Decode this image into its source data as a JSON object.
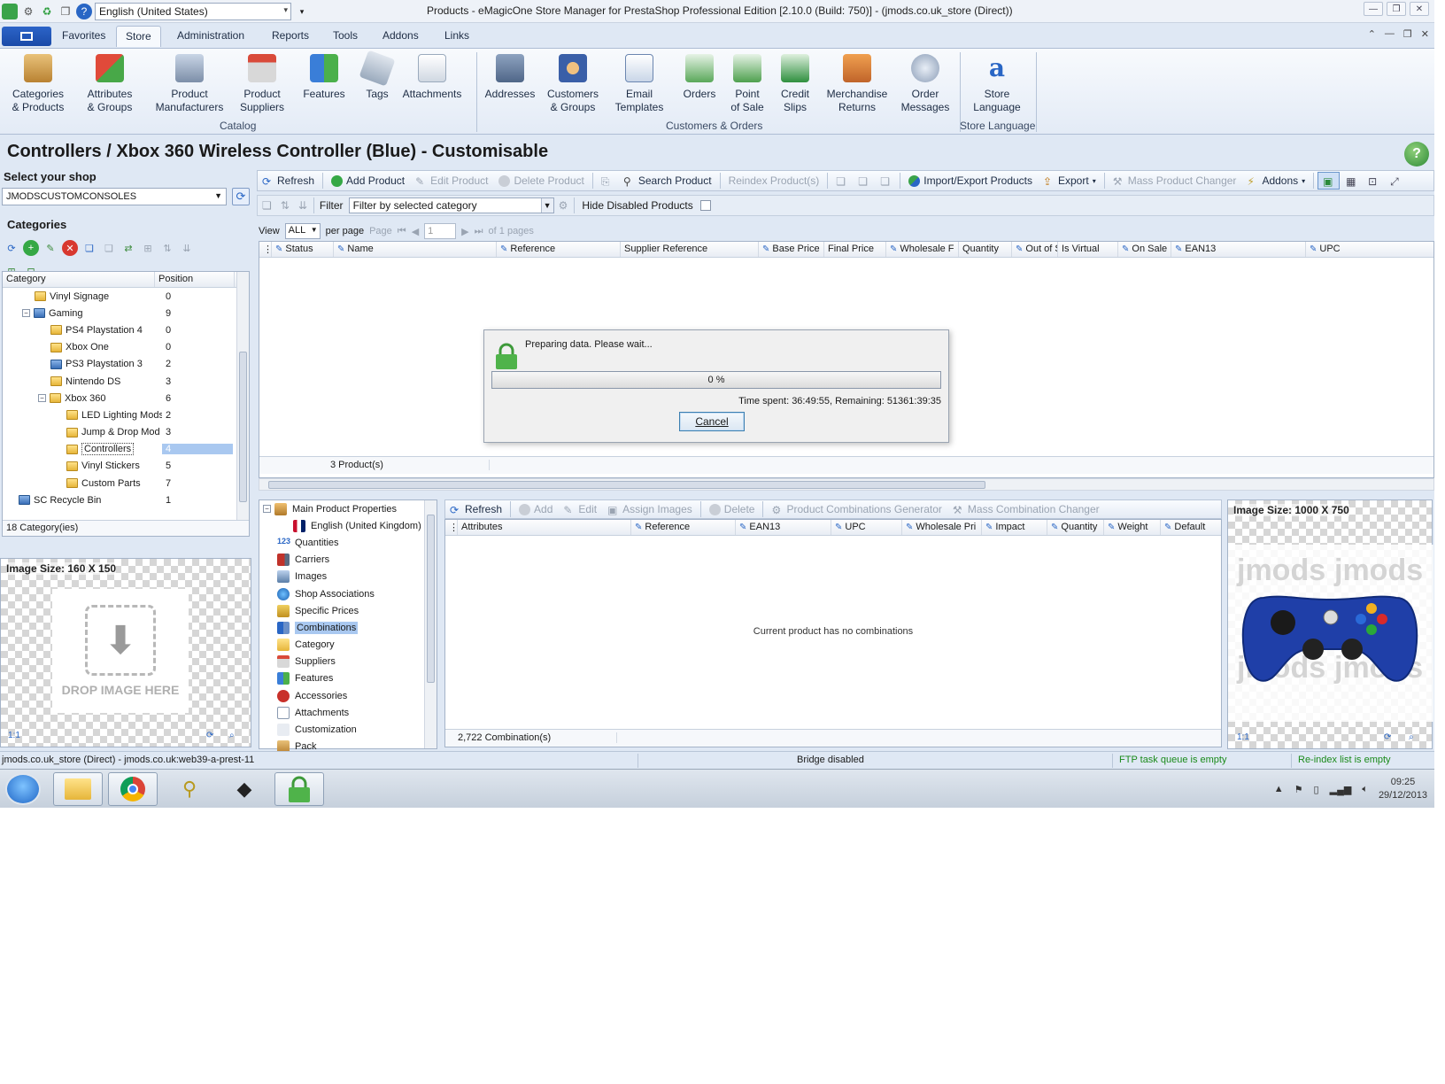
{
  "window": {
    "title": "Products - eMagicOne Store Manager for PrestaShop Professional Edition [2.10.0 (Build: 750)] - (jmods.co.uk_store (Direct))",
    "language": "English (United States)"
  },
  "ribbon_tabs": [
    "Favorites",
    "Store",
    "Administration",
    "Reports",
    "Tools",
    "Addons",
    "Links"
  ],
  "ribbon": {
    "catalog": {
      "group_label": "Catalog",
      "buttons": [
        {
          "line1": "Categories",
          "line2": "& Products"
        },
        {
          "line1": "Attributes",
          "line2": "& Groups"
        },
        {
          "line1": "Product",
          "line2": "Manufacturers"
        },
        {
          "line1": "Product",
          "line2": "Suppliers"
        },
        {
          "line1": "Features",
          "line2": ""
        },
        {
          "line1": "Tags",
          "line2": ""
        },
        {
          "line1": "Attachments",
          "line2": ""
        }
      ]
    },
    "customers": {
      "group_label": "Customers & Orders",
      "buttons": [
        {
          "line1": "Addresses",
          "line2": ""
        },
        {
          "line1": "Customers",
          "line2": "& Groups"
        },
        {
          "line1": "Email",
          "line2": "Templates"
        },
        {
          "line1": "Orders",
          "line2": ""
        },
        {
          "line1": "Point",
          "line2": "of Sale"
        },
        {
          "line1": "Credit",
          "line2": "Slips"
        },
        {
          "line1": "Merchandise",
          "line2": "Returns"
        },
        {
          "line1": "Order",
          "line2": "Messages"
        }
      ]
    },
    "language": {
      "group_label": "Store Language",
      "buttons": [
        {
          "line1": "Store",
          "line2": "Language"
        }
      ]
    }
  },
  "page_heading": "Controllers / Xbox 360 Wireless Controller (Blue) - Customisable",
  "left": {
    "select_shop_label": "Select your shop",
    "shop_value": "JMODSCUSTOMCONSOLES",
    "categories_label": "Categories",
    "grid_headers": [
      "Category",
      "Position"
    ],
    "rows": [
      {
        "name": "Vinyl Signage",
        "pos": "0"
      },
      {
        "name": "Gaming",
        "pos": "9"
      },
      {
        "name": "PS4 Playstation 4",
        "pos": "0"
      },
      {
        "name": "Xbox One",
        "pos": "0"
      },
      {
        "name": "PS3 Playstation 3",
        "pos": "2"
      },
      {
        "name": "Nintendo DS",
        "pos": "3"
      },
      {
        "name": "Xbox 360",
        "pos": "6"
      },
      {
        "name": "LED Lighting Mods",
        "pos": "2"
      },
      {
        "name": "Jump & Drop Mod",
        "pos": "3"
      },
      {
        "name": "Controllers",
        "pos": "4"
      },
      {
        "name": "Vinyl Stickers",
        "pos": "5"
      },
      {
        "name": "Custom Parts",
        "pos": "7"
      },
      {
        "name": "SC Recycle Bin",
        "pos": "1"
      }
    ],
    "footer": "18 Category(ies)",
    "image_size": "Image Size: 160 X 150",
    "drop_text": "DROP IMAGE HERE"
  },
  "toolbar": {
    "refresh": "Refresh",
    "add_product": "Add Product",
    "edit_product": "Edit Product",
    "delete_product": "Delete Product",
    "search_product": "Search Product",
    "reindex": "Reindex Product(s)",
    "import_export": "Import/Export Products",
    "export": "Export",
    "mass_changer": "Mass Product Changer",
    "addons": "Addons"
  },
  "filter": {
    "label": "Filter",
    "value": "Filter by selected category",
    "hide_disabled": "Hide Disabled Products"
  },
  "pager": {
    "view_label": "View",
    "view_value": "ALL",
    "per_page": "per page",
    "page_label": "Page",
    "page_value": "1",
    "of_pages": "of 1 pages"
  },
  "product_columns": [
    "Status",
    "Name",
    "Reference",
    "Supplier Reference",
    "Base Price",
    "Final Price",
    "Wholesale F",
    "Quantity",
    "Out of S",
    "Is Virtual",
    "On Sale",
    "EAN13",
    "UPC"
  ],
  "product_footer": "3 Product(s)",
  "dialog": {
    "message": "Preparing data. Please wait...",
    "progress_label": "0 %",
    "progress_value": 0,
    "time_info": "Time spent: 36:49:55,  Remaining: 51361:39:35",
    "cancel": "Cancel"
  },
  "properties_tree": [
    "Main Product Properties",
    "English (United Kingdom)",
    "Quantities",
    "Carriers",
    "Images",
    "Shop Associations",
    "Specific Prices",
    "Combinations",
    "Category",
    "Suppliers",
    "Features",
    "Accessories",
    "Attachments",
    "Customization",
    "Pack"
  ],
  "combinations": {
    "toolbar": {
      "refresh": "Refresh",
      "add": "Add",
      "edit": "Edit",
      "assign_images": "Assign Images",
      "delete": "Delete",
      "generator": "Product Combinations Generator",
      "mass_changer": "Mass Combination Changer"
    },
    "columns": [
      "Attributes",
      "Reference",
      "EAN13",
      "UPC",
      "Wholesale Pri",
      "Impact",
      "Quantity",
      "Weight",
      "Default"
    ],
    "empty_text": "Current product has no combinations",
    "footer": "2,722 Combination(s)"
  },
  "product_image": {
    "size": "Image Size: 1000 X 750",
    "watermark": "jmods"
  },
  "status": {
    "connection": "jmods.co.uk_store (Direct) - jmods.co.uk:web39-a-prest-11",
    "bridge": "Bridge disabled",
    "ftp": "FTP task queue is empty",
    "reindex": "Re-index list is empty"
  },
  "taskbar": {
    "time": "09:25",
    "date": "29/12/2013"
  },
  "colors": {
    "accent": "#2966c5",
    "status_green": "#1a8a1a",
    "progress_green": "#3cb34a",
    "selection": "#a9c8f0"
  }
}
